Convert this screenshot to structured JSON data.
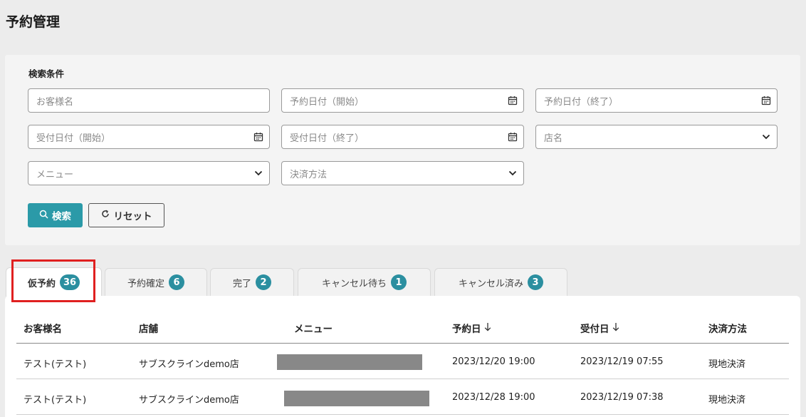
{
  "page_title": "予約管理",
  "search": {
    "heading": "検索条件",
    "fields": {
      "customer_name": "お客様名",
      "reserve_date_start": "予約日付（開始）",
      "reserve_date_end": "予約日付（終了）",
      "received_date_start": "受付日付（開始）",
      "received_date_end": "受付日付（終了）",
      "store_name": "店名",
      "menu": "メニュー",
      "payment_method": "決済方法"
    },
    "search_button": "検索",
    "reset_button": "リセット"
  },
  "tabs": [
    {
      "label": "仮予約",
      "count": "36",
      "active": true
    },
    {
      "label": "予約確定",
      "count": "6"
    },
    {
      "label": "完了",
      "count": "2"
    },
    {
      "label": "キャンセル待ち",
      "count": "1"
    },
    {
      "label": "キャンセル済み",
      "count": "3"
    }
  ],
  "table": {
    "headers": {
      "customer": "お客様名",
      "store": "店舗",
      "menu": "メニュー",
      "reserve_date": "予約日",
      "received_date": "受付日",
      "payment": "決済方法"
    },
    "rows": [
      {
        "customer": "テスト(テスト)",
        "store": "サブスクラインdemo店",
        "reserve_date": "2023/12/20 19:00",
        "received_date": "2023/12/19 07:55",
        "payment": "現地決済"
      },
      {
        "customer": "テスト(テスト)",
        "store": "サブスクラインdemo店",
        "reserve_date": "2023/12/28 19:00",
        "received_date": "2023/12/19 07:38",
        "payment": "現地決済"
      }
    ]
  },
  "colors": {
    "accent": "#2b9aa8",
    "highlight": "#e02020"
  },
  "icons": {
    "calendar": "calendar-icon",
    "dropdown": "chevron-down-icon",
    "search": "search-icon",
    "reset": "refresh-icon",
    "sort": "arrow-down-icon"
  }
}
